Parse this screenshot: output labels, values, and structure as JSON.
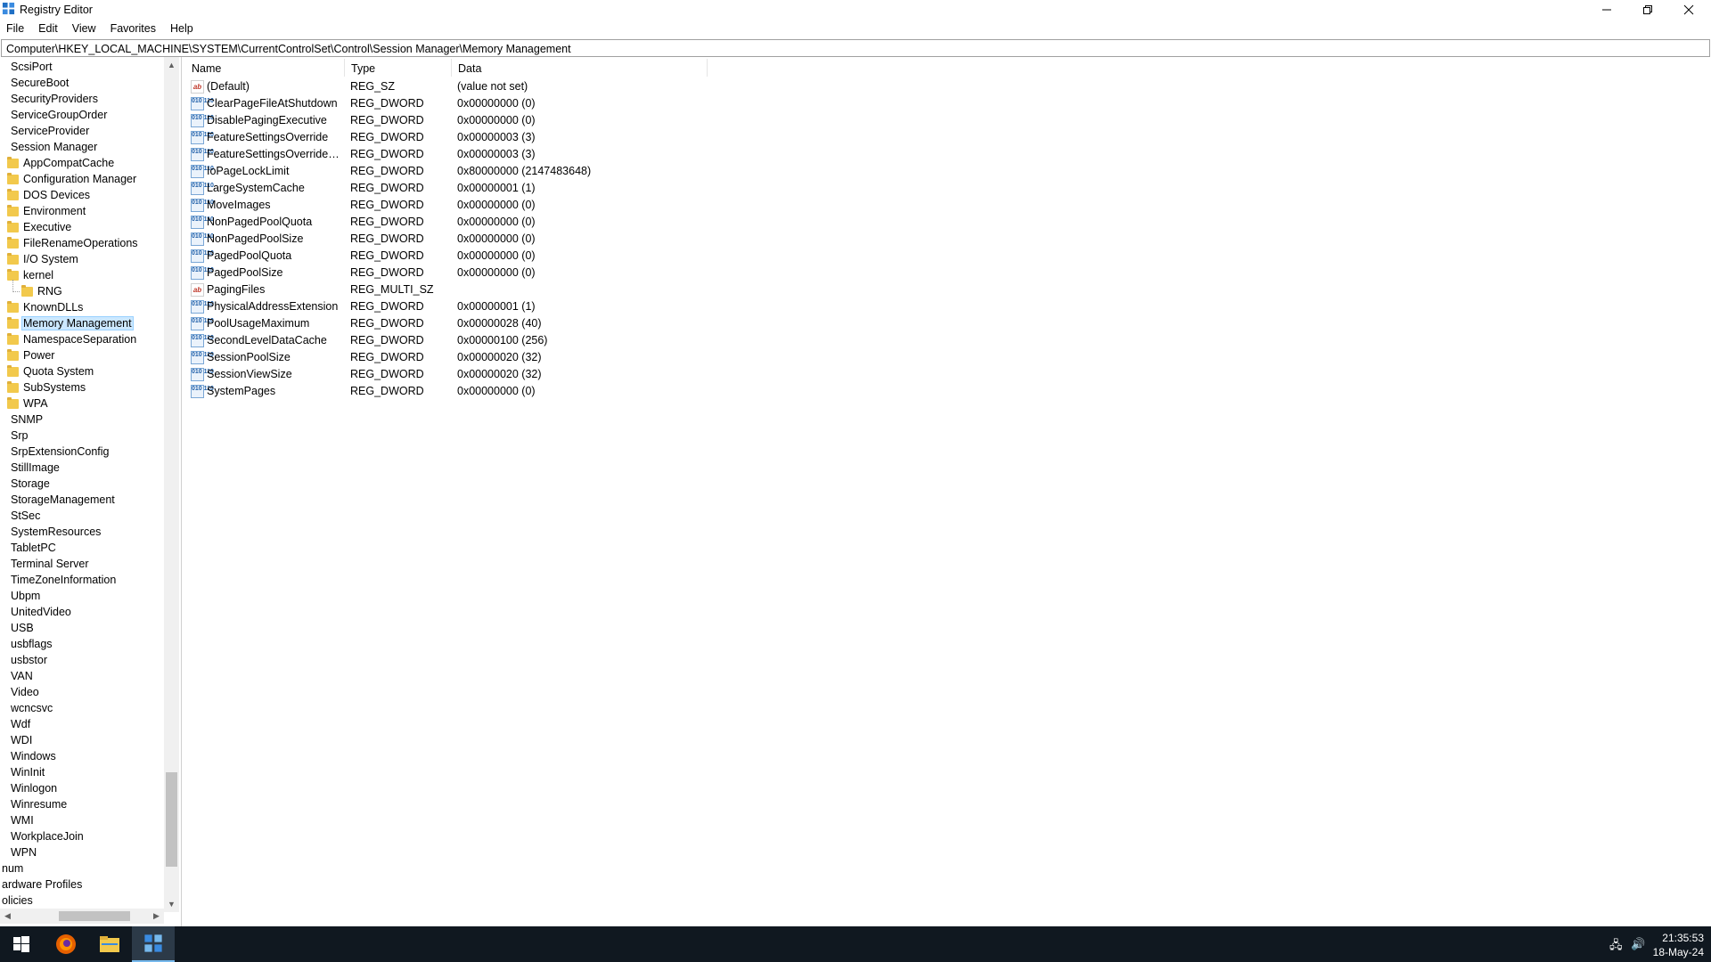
{
  "window": {
    "title": "Registry Editor",
    "controls": {
      "minimize": "—",
      "maximize": "❐",
      "close": "✕"
    }
  },
  "menu": [
    "File",
    "Edit",
    "View",
    "Favorites",
    "Help"
  ],
  "address": "Computer\\HKEY_LOCAL_MACHINE\\SYSTEM\\CurrentControlSet\\Control\\Session Manager\\Memory Management",
  "tree": {
    "items": [
      {
        "label": "ScsiPort",
        "level": 1,
        "folder": false
      },
      {
        "label": "SecureBoot",
        "level": 1,
        "folder": false
      },
      {
        "label": "SecurityProviders",
        "level": 1,
        "folder": false
      },
      {
        "label": "ServiceGroupOrder",
        "level": 1,
        "folder": false
      },
      {
        "label": "ServiceProvider",
        "level": 1,
        "folder": false
      },
      {
        "label": "Session Manager",
        "level": 1,
        "folder": false
      },
      {
        "label": "AppCompatCache",
        "level": 2,
        "folder": true
      },
      {
        "label": "Configuration Manager",
        "level": 2,
        "folder": true
      },
      {
        "label": "DOS Devices",
        "level": 2,
        "folder": true
      },
      {
        "label": "Environment",
        "level": 2,
        "folder": true
      },
      {
        "label": "Executive",
        "level": 2,
        "folder": true
      },
      {
        "label": "FileRenameOperations",
        "level": 2,
        "folder": true
      },
      {
        "label": "I/O System",
        "level": 2,
        "folder": true
      },
      {
        "label": "kernel",
        "level": 2,
        "folder": true
      },
      {
        "label": "RNG",
        "level": 3,
        "folder": true
      },
      {
        "label": "KnownDLLs",
        "level": 2,
        "folder": true
      },
      {
        "label": "Memory Management",
        "level": 2,
        "folder": true,
        "selected": true
      },
      {
        "label": "NamespaceSeparation",
        "level": 2,
        "folder": true
      },
      {
        "label": "Power",
        "level": 2,
        "folder": true
      },
      {
        "label": "Quota System",
        "level": 2,
        "folder": true
      },
      {
        "label": "SubSystems",
        "level": 2,
        "folder": true
      },
      {
        "label": "WPA",
        "level": 2,
        "folder": true
      },
      {
        "label": "SNMP",
        "level": 1,
        "folder": false
      },
      {
        "label": "Srp",
        "level": 1,
        "folder": false
      },
      {
        "label": "SrpExtensionConfig",
        "level": 1,
        "folder": false
      },
      {
        "label": "StillImage",
        "level": 1,
        "folder": false
      },
      {
        "label": "Storage",
        "level": 1,
        "folder": false
      },
      {
        "label": "StorageManagement",
        "level": 1,
        "folder": false
      },
      {
        "label": "StSec",
        "level": 1,
        "folder": false
      },
      {
        "label": "SystemResources",
        "level": 1,
        "folder": false
      },
      {
        "label": "TabletPC",
        "level": 1,
        "folder": false
      },
      {
        "label": "Terminal Server",
        "level": 1,
        "folder": false
      },
      {
        "label": "TimeZoneInformation",
        "level": 1,
        "folder": false
      },
      {
        "label": "Ubpm",
        "level": 1,
        "folder": false
      },
      {
        "label": "UnitedVideo",
        "level": 1,
        "folder": false
      },
      {
        "label": "USB",
        "level": 1,
        "folder": false
      },
      {
        "label": "usbflags",
        "level": 1,
        "folder": false
      },
      {
        "label": "usbstor",
        "level": 1,
        "folder": false
      },
      {
        "label": "VAN",
        "level": 1,
        "folder": false
      },
      {
        "label": "Video",
        "level": 1,
        "folder": false
      },
      {
        "label": "wcncsvc",
        "level": 1,
        "folder": false
      },
      {
        "label": "Wdf",
        "level": 1,
        "folder": false
      },
      {
        "label": "WDI",
        "level": 1,
        "folder": false
      },
      {
        "label": "Windows",
        "level": 1,
        "folder": false
      },
      {
        "label": "WinInit",
        "level": 1,
        "folder": false
      },
      {
        "label": "Winlogon",
        "level": 1,
        "folder": false
      },
      {
        "label": "Winresume",
        "level": 1,
        "folder": false
      },
      {
        "label": "WMI",
        "level": 1,
        "folder": false
      },
      {
        "label": "WorkplaceJoin",
        "level": 1,
        "folder": false
      },
      {
        "label": "WPN",
        "level": 1,
        "folder": false
      },
      {
        "label": "num",
        "level": 0,
        "folder": false
      },
      {
        "label": "ardware Profiles",
        "level": 0,
        "folder": false
      },
      {
        "label": "olicies",
        "level": 0,
        "folder": false
      }
    ]
  },
  "columns": {
    "name": "Name",
    "type": "Type",
    "data": "Data"
  },
  "values": [
    {
      "icon": "string-value-icon",
      "name": "(Default)",
      "type": "REG_SZ",
      "data": "(value not set)"
    },
    {
      "icon": "binary-value-icon",
      "name": "ClearPageFileAtShutdown",
      "type": "REG_DWORD",
      "data": "0x00000000 (0)"
    },
    {
      "icon": "binary-value-icon",
      "name": "DisablePagingExecutive",
      "type": "REG_DWORD",
      "data": "0x00000000 (0)"
    },
    {
      "icon": "binary-value-icon",
      "name": "FeatureSettingsOverride",
      "type": "REG_DWORD",
      "data": "0x00000003 (3)"
    },
    {
      "icon": "binary-value-icon",
      "name": "FeatureSettingsOverrideMa...",
      "type": "REG_DWORD",
      "data": "0x00000003 (3)"
    },
    {
      "icon": "binary-value-icon",
      "name": "IoPageLockLimit",
      "type": "REG_DWORD",
      "data": "0x80000000 (2147483648)"
    },
    {
      "icon": "binary-value-icon",
      "name": "LargeSystemCache",
      "type": "REG_DWORD",
      "data": "0x00000001 (1)"
    },
    {
      "icon": "binary-value-icon",
      "name": "MoveImages",
      "type": "REG_DWORD",
      "data": "0x00000000 (0)"
    },
    {
      "icon": "binary-value-icon",
      "name": "NonPagedPoolQuota",
      "type": "REG_DWORD",
      "data": "0x00000000 (0)"
    },
    {
      "icon": "binary-value-icon",
      "name": "NonPagedPoolSize",
      "type": "REG_DWORD",
      "data": "0x00000000 (0)"
    },
    {
      "icon": "binary-value-icon",
      "name": "PagedPoolQuota",
      "type": "REG_DWORD",
      "data": "0x00000000 (0)"
    },
    {
      "icon": "binary-value-icon",
      "name": "PagedPoolSize",
      "type": "REG_DWORD",
      "data": "0x00000000 (0)"
    },
    {
      "icon": "string-value-icon",
      "name": "PagingFiles",
      "type": "REG_MULTI_SZ",
      "data": ""
    },
    {
      "icon": "binary-value-icon",
      "name": "PhysicalAddressExtension",
      "type": "REG_DWORD",
      "data": "0x00000001 (1)"
    },
    {
      "icon": "binary-value-icon",
      "name": "PoolUsageMaximum",
      "type": "REG_DWORD",
      "data": "0x00000028 (40)"
    },
    {
      "icon": "binary-value-icon",
      "name": "SecondLevelDataCache",
      "type": "REG_DWORD",
      "data": "0x00000100 (256)"
    },
    {
      "icon": "binary-value-icon",
      "name": "SessionPoolSize",
      "type": "REG_DWORD",
      "data": "0x00000020 (32)"
    },
    {
      "icon": "binary-value-icon",
      "name": "SessionViewSize",
      "type": "REG_DWORD",
      "data": "0x00000020 (32)"
    },
    {
      "icon": "binary-value-icon",
      "name": "SystemPages",
      "type": "REG_DWORD",
      "data": "0x00000000 (0)"
    }
  ],
  "taskbar": {
    "apps": [
      "start-button",
      "firefox-icon",
      "file-explorer-icon",
      "registry-editor-icon"
    ],
    "time": "21:35:53",
    "date": "18-May-24"
  }
}
